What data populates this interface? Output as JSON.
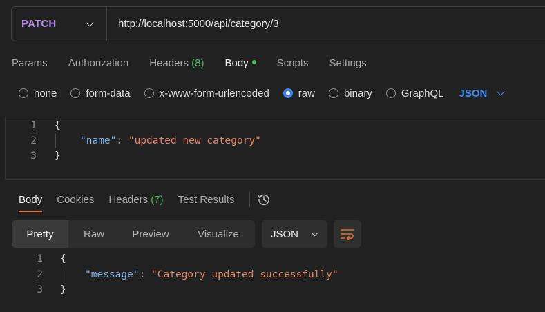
{
  "request": {
    "method": "PATCH",
    "url": "http://localhost:5000/api/category/3"
  },
  "request_tabs": [
    {
      "label": "Params"
    },
    {
      "label": "Authorization"
    },
    {
      "label": "Headers",
      "count": "(8)"
    },
    {
      "label": "Body",
      "active": true
    },
    {
      "label": "Scripts"
    },
    {
      "label": "Settings"
    }
  ],
  "body_types": [
    "none",
    "form-data",
    "x-www-form-urlencoded",
    "raw",
    "binary",
    "GraphQL"
  ],
  "body_type_selected": "raw",
  "raw_format": "JSON",
  "request_body": {
    "lines": [
      "1",
      "2",
      "3"
    ],
    "open_brace": "{",
    "key": "\"name\"",
    "colon": ": ",
    "value": "\"updated new category\"",
    "close_brace": "}"
  },
  "response_tabs": [
    {
      "label": "Body",
      "active": true
    },
    {
      "label": "Cookies"
    },
    {
      "label": "Headers",
      "count": "(7)"
    },
    {
      "label": "Test Results"
    }
  ],
  "view_modes": [
    "Pretty",
    "Raw",
    "Preview",
    "Visualize"
  ],
  "view_mode_selected": "Pretty",
  "response_format": "JSON",
  "response_body": {
    "lines": [
      "1",
      "2",
      "3"
    ],
    "open_brace": "{",
    "key": "\"message\"",
    "colon": ": ",
    "value": "\"Category updated successfully\"",
    "close_brace": "}"
  },
  "icons": {
    "method_dropdown": "chevron-down-icon",
    "history": "history-icon",
    "wrap": "wrap-lines-icon"
  },
  "colors": {
    "method": "#b388e8",
    "accent_blue": "#3f8ef5",
    "active_tab_underline": "#e8702a",
    "json_key": "#7fb4e8",
    "json_string": "#e0876a",
    "status_green": "#4cb35a"
  }
}
